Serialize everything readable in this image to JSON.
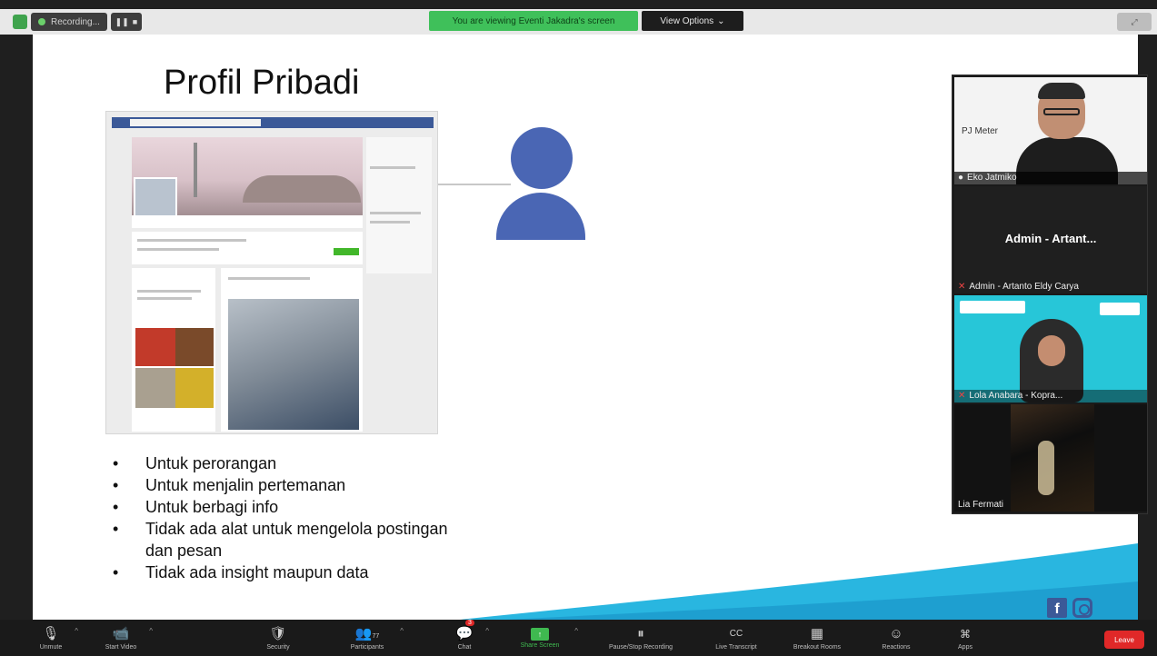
{
  "top_bar": {
    "recording_label": "Recording...",
    "viewing_banner": "You are viewing Eventi Jakadra's screen",
    "view_options_label": "View Options",
    "view_options_caret": "⌄"
  },
  "slide": {
    "title": "Profil Pribadi",
    "bullets": [
      "Untuk perorangan",
      "Untuk menjalin pertemanan",
      "Untuk berbagi info",
      "Tidak ada alat untuk mengelola postingan",
      "dan pesan",
      "Tidak ada insight maupun data"
    ],
    "social": {
      "fb_letter": "f"
    }
  },
  "participants": [
    {
      "name": "Eko Jatmiko",
      "label_in_video": "PJ Meter",
      "muted": false
    },
    {
      "name": "Admin - Artanto Eldy Carya",
      "center_label": "Admin - Artant...",
      "muted": true
    },
    {
      "name": "Lola Anabara - Kopra...",
      "muted": true
    },
    {
      "name": "Lia Fermati",
      "muted": false
    }
  ],
  "toolbar": {
    "items": [
      {
        "label": "Unmute",
        "icon": "🎙"
      },
      {
        "label": "Start Video",
        "icon": "📹"
      },
      {
        "label": "Security",
        "icon": "🛡"
      },
      {
        "label": "Participants",
        "icon": "👥",
        "count": "77"
      },
      {
        "label": "Chat",
        "icon": "💬",
        "badge": "3"
      },
      {
        "label": "Share Screen",
        "icon": "↑"
      },
      {
        "label": "Pause/Stop Recording",
        "icon": "⏸"
      },
      {
        "label": "Live Transcript",
        "icon": "CC"
      },
      {
        "label": "Breakout Rooms",
        "icon": "▦"
      },
      {
        "label": "Reactions",
        "icon": "☺"
      },
      {
        "label": "Apps",
        "icon": "⌘"
      }
    ],
    "leave_label": "Leave"
  },
  "colors": {
    "zoom_green": "#3fc05a",
    "leave_red": "#e02828",
    "avatar_blue": "#4a66b4",
    "wave_cyan": "#29b6e0",
    "facebook_blue": "#3b5998"
  }
}
